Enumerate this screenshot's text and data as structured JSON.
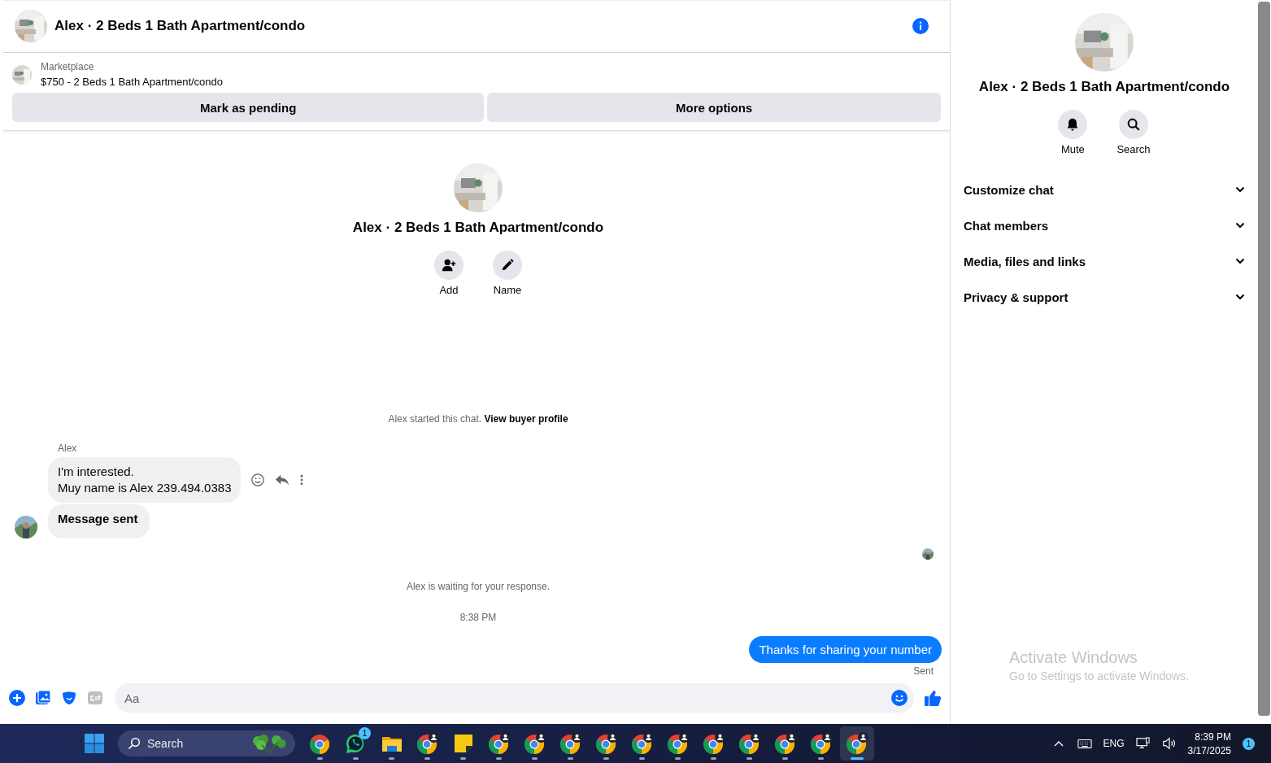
{
  "header": {
    "title": "Alex · 2 Beds 1 Bath Apartment/condo"
  },
  "listing": {
    "source": "Marketplace",
    "title": "$750 - 2 Beds 1 Bath Apartment/condo",
    "buttons": [
      "Mark as pending",
      "More options"
    ]
  },
  "intro": {
    "title": "Alex · 2 Beds 1 Bath Apartment/condo",
    "actions": [
      {
        "kind": "add",
        "label": "Add"
      },
      {
        "kind": "edit",
        "label": "Name"
      }
    ]
  },
  "started": {
    "text": "Alex started this chat.",
    "link": "View buyer profile"
  },
  "incoming": {
    "sender": "Alex",
    "bubbles": [
      {
        "kind": "text",
        "lines": [
          "I'm interested.",
          "Muy name is Alex 239.494.0383"
        ]
      },
      {
        "kind": "bold",
        "lines": [
          "Message sent"
        ]
      }
    ]
  },
  "waiting": "Alex is waiting for your response.",
  "time": "8:38 PM",
  "outgoing": {
    "text": "Thanks for sharing your number",
    "status": "Sent"
  },
  "composer": {
    "placeholder": "Aa"
  },
  "sidebar": {
    "title": "Alex · 2 Beds 1 Bath Apartment/condo",
    "actions": [
      {
        "kind": "mute",
        "label": "Mute"
      },
      {
        "kind": "search",
        "label": "Search"
      }
    ],
    "sections": [
      {
        "label": "Customize chat",
        "expanded": false
      },
      {
        "label": "Chat members",
        "expanded": false
      },
      {
        "label": "Media, files and links",
        "expanded": false
      },
      {
        "label": "Privacy & support",
        "expanded": false
      }
    ]
  },
  "activation": {
    "title": "Activate Windows",
    "subtitle": "Go to Settings to activate Windows."
  },
  "taskbar": {
    "search": {
      "placeholder": "Search"
    },
    "apps": [
      {
        "kind": "chrome",
        "profile": false,
        "active": false
      },
      {
        "kind": "whatsapp",
        "badge": "1",
        "active": false
      },
      {
        "kind": "folder",
        "active": false
      },
      {
        "kind": "chrome",
        "profile": true,
        "active": false
      },
      {
        "kind": "notes",
        "active": false
      },
      {
        "kind": "chrome",
        "profile": true,
        "active": false
      },
      {
        "kind": "chrome",
        "profile": true,
        "active": false
      },
      {
        "kind": "chrome",
        "profile": true,
        "active": false
      },
      {
        "kind": "chrome",
        "profile": true,
        "active": false
      },
      {
        "kind": "chrome",
        "profile": true,
        "active": false
      },
      {
        "kind": "chrome",
        "profile": true,
        "active": false
      },
      {
        "kind": "chrome",
        "profile": true,
        "active": false
      },
      {
        "kind": "chrome",
        "profile": true,
        "active": false
      },
      {
        "kind": "chrome",
        "profile": true,
        "active": false
      },
      {
        "kind": "chrome",
        "profile": true,
        "active": false
      },
      {
        "kind": "chrome",
        "profile": true,
        "active": true
      }
    ],
    "language": "ENG",
    "time": "8:39 PM",
    "date": "3/17/2025",
    "notifications": "1"
  }
}
